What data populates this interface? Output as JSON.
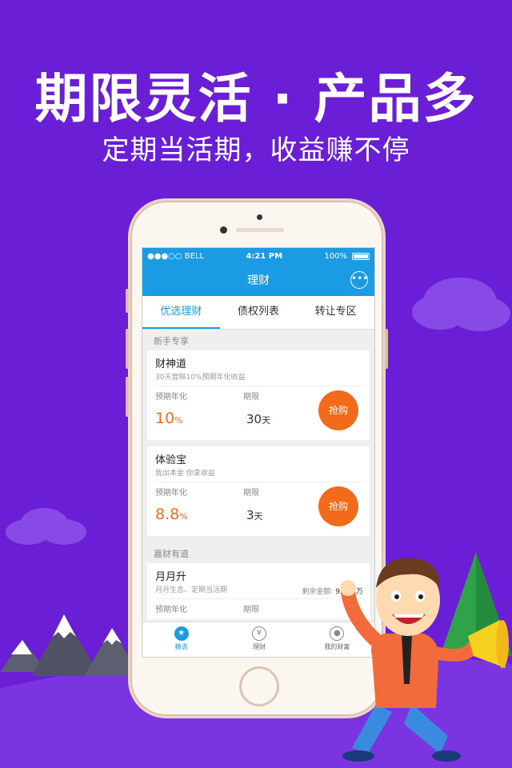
{
  "headline": "期限灵活 · 产品多",
  "subline": "定期当活期，收益赚不停",
  "colors": {
    "background": "#6a1fd6",
    "accent": "#1a9be3",
    "orange": "#f26b1d"
  },
  "status_bar": {
    "carrier": "●●●○○ BELL",
    "time": "4:21 PM",
    "battery": "100%"
  },
  "nav": {
    "title": "理财",
    "more_icon": "more-icon"
  },
  "tabs": [
    {
      "label": "优选理财",
      "active": true
    },
    {
      "label": "债权列表",
      "active": false
    },
    {
      "label": "转让专区",
      "active": false
    }
  ],
  "sections": {
    "newbie": "新手专享",
    "jiacai": "嘉财有道"
  },
  "products": [
    {
      "name": "财神道",
      "desc": "30天尝鲜10%预期年化收益",
      "rate_label": "预期年化",
      "term_label": "期限",
      "rate": "10",
      "rate_unit": "%",
      "term": "30",
      "term_unit": "天",
      "button": "抢购"
    },
    {
      "name": "体验宝",
      "desc": "我出本金 你拿收益",
      "rate_label": "预期年化",
      "term_label": "期限",
      "rate": "8.8",
      "rate_unit": "%",
      "term": "3",
      "term_unit": "天",
      "button": "抢购"
    },
    {
      "name": "月月升",
      "desc": "月月生息、定期当活期",
      "rate_label": "预期年化",
      "term_label": "期限",
      "remain_label": "剩余金额:",
      "remain_value": "92.43万"
    }
  ],
  "tabbar": [
    {
      "label": "精选",
      "icon": "star-icon",
      "active": true
    },
    {
      "label": "理财",
      "icon": "money-bag-icon",
      "active": false
    },
    {
      "label": "我的财富",
      "icon": "user-icon",
      "active": false
    }
  ]
}
